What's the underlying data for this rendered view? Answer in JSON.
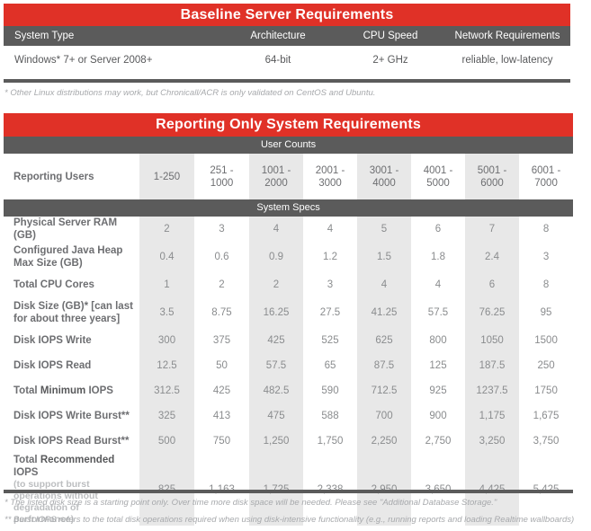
{
  "table1": {
    "title": "Baseline Server Requirements",
    "headers": [
      "System Type",
      "Architecture",
      "CPU Speed",
      "Network Requirements"
    ],
    "rows": [
      [
        "Windows* 7+ or Server 2008+",
        "64-bit",
        "2+ GHz",
        "reliable, low-latency"
      ]
    ],
    "footnote": "* Other Linux distributions may work, but Chronicall/ACR is only validated on CentOS and Ubuntu."
  },
  "table2": {
    "title": "Reporting Only System Requirements",
    "band_user_counts": "User Counts",
    "band_system_specs": "System Specs",
    "row_header_label": "Reporting Users",
    "user_counts": [
      "1-250",
      "251 - 1000",
      "1001 - 2000",
      "2001 - 3000",
      "3001 - 4000",
      "4001 - 5000",
      "5001 - 6000",
      "6001 - 7000"
    ],
    "user_counts_lines": [
      [
        "1-250",
        ""
      ],
      [
        "251 -",
        "1000"
      ],
      [
        "1001 -",
        "2000"
      ],
      [
        "2001 -",
        "3000"
      ],
      [
        "3001 -",
        "4000"
      ],
      [
        "4001 -",
        "5000"
      ],
      [
        "5001 -",
        "6000"
      ],
      [
        "6001 -",
        "7000"
      ]
    ],
    "rows": [
      {
        "label_pre": "Physical Server RAM (GB)",
        "label_bold": "",
        "label_post": "",
        "label_sub": "",
        "values": [
          "2",
          "3",
          "4",
          "4",
          "5",
          "6",
          "7",
          "8"
        ]
      },
      {
        "label_pre": "Configured Java Heap Max Size (GB)",
        "label_bold": "",
        "label_post": "",
        "label_sub": "",
        "values": [
          "0.4",
          "0.6",
          "0.9",
          "1.2",
          "1.5",
          "1.8",
          "2.4",
          "3"
        ]
      },
      {
        "label_pre": "Total CPU Cores",
        "label_bold": "",
        "label_post": "",
        "label_sub": "",
        "values": [
          "1",
          "2",
          "2",
          "3",
          "4",
          "4",
          "6",
          "8"
        ]
      },
      {
        "label_pre": "Disk Size (GB)* [can last for about three years]",
        "label_bold": "",
        "label_post": "",
        "label_sub": "",
        "values": [
          "3.5",
          "8.75",
          "16.25",
          "27.5",
          "41.25",
          "57.5",
          "76.25",
          "95"
        ]
      },
      {
        "label_pre": "Disk IOPS Write",
        "label_bold": "",
        "label_post": "",
        "label_sub": "",
        "values": [
          "300",
          "375",
          "425",
          "525",
          "625",
          "800",
          "1050",
          "1500"
        ]
      },
      {
        "label_pre": "Disk IOPS Read",
        "label_bold": "",
        "label_post": "",
        "label_sub": "",
        "values": [
          "12.5",
          "50",
          "57.5",
          "65",
          "87.5",
          "125",
          "187.5",
          "250"
        ]
      },
      {
        "label_pre": "Total ",
        "label_bold": "Minimum",
        "label_post": " IOPS",
        "label_sub": "",
        "values": [
          "312.5",
          "425",
          "482.5",
          "590",
          "712.5",
          "925",
          "1237.5",
          "1750"
        ]
      },
      {
        "label_pre": "Disk IOPS Write Burst**",
        "label_bold": "",
        "label_post": "",
        "label_sub": "",
        "values": [
          "325",
          "413",
          "475",
          "588",
          "700",
          "900",
          "1,175",
          "1,675"
        ]
      },
      {
        "label_pre": "Disk IOPS Read Burst**",
        "label_bold": "",
        "label_post": "",
        "label_sub": "",
        "values": [
          "500",
          "750",
          "1,250",
          "1,750",
          "2,250",
          "2,750",
          "3,250",
          "3,750"
        ]
      },
      {
        "label_pre": "Total ",
        "label_bold": "Recommended",
        "label_post": " IOPS",
        "label_sub": "(to support burst operations without degradation of performance)",
        "values": [
          "825",
          "1,163",
          "1,725",
          "2,338",
          "2,950",
          "3,650",
          "4,425",
          "5,425"
        ]
      }
    ],
    "footnotes": [
      "* The listed disk size is a starting point only. Over time more disk space will be needed. Please see \"Additional Database Storage.\"",
      "** Burst IOPS refers to the total disk operations required when using disk-intensive functionality (e.g., running reports and loading Realtime wallboards)"
    ]
  },
  "colors": {
    "banner_red": "#e03127",
    "band_gray": "#5b5b5b",
    "alt_column": "#e8e8e8",
    "text_gray": "#6d6e71",
    "footnote_gray": "#a7a9ac"
  }
}
